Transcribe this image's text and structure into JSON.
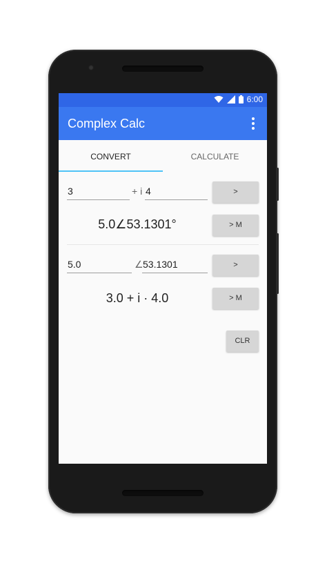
{
  "status_bar": {
    "time": "6:00",
    "icons": [
      "wifi-icon",
      "signal-icon",
      "battery-icon"
    ]
  },
  "app_bar": {
    "title": "Complex Calc",
    "overflow_icon": "more-vert-icon"
  },
  "tabs": [
    {
      "label": "CONVERT",
      "selected": true
    },
    {
      "label": "CALCULATE",
      "selected": false
    }
  ],
  "rectangular_to_polar": {
    "real_value": "3",
    "imag_operator": "+ i",
    "imag_value": "4",
    "convert_button": ">",
    "result": "5.0∠53.1301°",
    "memory_button": "> M"
  },
  "polar_to_rectangular": {
    "magnitude_value": "5.0",
    "angle_symbol": "∠",
    "angle_value": "53.1301",
    "convert_button": ">",
    "result": "3.0 + i · 4.0",
    "memory_button": "> M"
  },
  "clear_button": "CLR",
  "colors": {
    "status_bar": "#2f66e6",
    "app_bar": "#3a78f0",
    "tab_indicator": "#4fc3f7",
    "button": "#d6d6d6",
    "screen_background": "#fafafa"
  }
}
